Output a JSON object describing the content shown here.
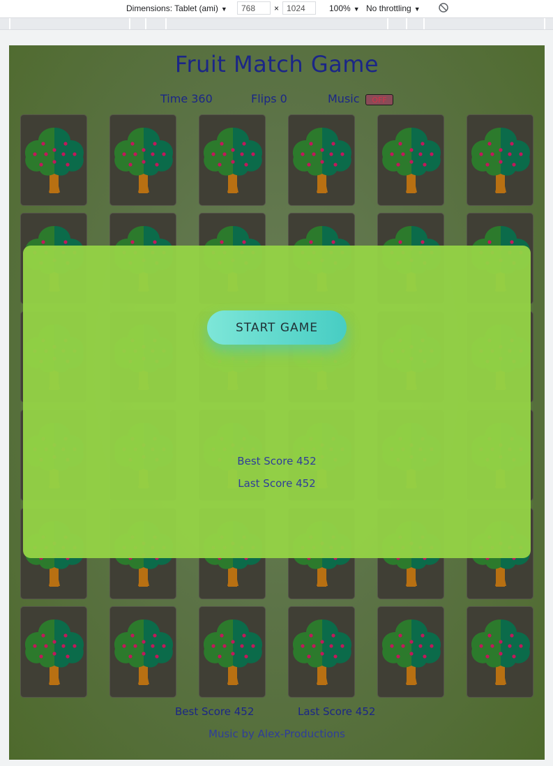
{
  "devtools": {
    "dimensions_label": "Dimensions: Tablet (ami)",
    "width": "768",
    "height": "1024",
    "times": "×",
    "zoom": "100%",
    "throttling": "No throttling"
  },
  "game": {
    "title": "Fruit Match Game",
    "time_label": "Time 360",
    "flips_label": "Flips 0",
    "music_label": "Music",
    "music_toggle": "OFF"
  },
  "overlay": {
    "start_button": "START GAME",
    "best_score": "Best Score 452",
    "last_score": "Last Score 452"
  },
  "footer": {
    "best_score": "Best Score 452",
    "last_score": "Last Score 452",
    "credit": "Music by Alex-Productions"
  },
  "card_back": {
    "icon": "tree-icon"
  },
  "colors": {
    "title": "#1b2687",
    "card": "#403f35",
    "overlay": "#94d246",
    "button_start": "#7de6d8",
    "button_end": "#47cdc3",
    "toggle_off": "#8a4b57"
  }
}
